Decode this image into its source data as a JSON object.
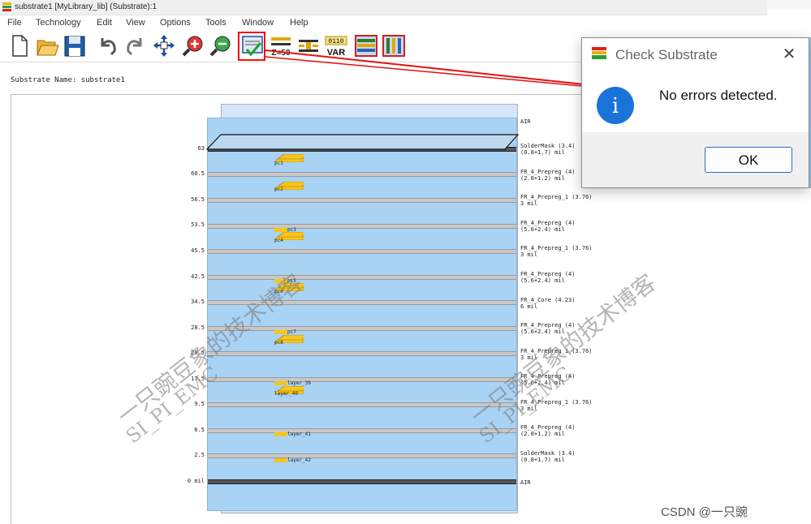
{
  "window": {
    "title": "substrate1 [MyLibrary_lib] (Substrate):1"
  },
  "menu": [
    "File",
    "Technology",
    "Edit",
    "View",
    "Options",
    "Tools",
    "Window",
    "Help"
  ],
  "toolbar": {
    "buttons": [
      "new-file-icon",
      "open-folder-icon",
      "save-icon",
      "undo-icon",
      "redo-icon",
      "move-icon",
      "zoom-in-icon",
      "zoom-out-icon",
      "check-substrate-icon",
      "z50-icon",
      "trace-icon",
      "var-icon",
      "layers-horizontal-icon",
      "layers-vertical-icon"
    ],
    "z50_label": "Z=50",
    "var_bits": "0110",
    "var_label": "VAR"
  },
  "substrate_name": "Substrate Name:  substrate1",
  "stack": {
    "y_labels": [
      "63",
      "60.5",
      "56.5",
      "53.5",
      "45.5",
      "42.5",
      "34.5",
      "28.5",
      "20.5",
      "17.5",
      "9.5",
      "6.5",
      "2.5",
      "0 mil"
    ],
    "layer_labels": [
      [
        "AIR",
        ""
      ],
      [
        "SolderMask (3.4)",
        "(0.8+1.7) mil"
      ],
      [
        "FR_4_Prepreg (4)",
        "(2.8+1.2) mil"
      ],
      [
        "FR_4_Prepreg_1 (3.76)",
        "3 mil"
      ],
      [
        "FR_4_Prepreg (4)",
        "(5.6+2.4) mil"
      ],
      [
        "FR_4_Prepreg_1 (3.76)",
        "3 mil"
      ],
      [
        "FR_4_Prepreg (4)",
        "(5.6+2.4) mil"
      ],
      [
        "FR_4_Core (4.23)",
        "6 mil"
      ],
      [
        "FR_4_Prepreg (4)",
        "(5.6+2.4) mil"
      ],
      [
        "FR_4_Prepreg_1 (3.76)",
        "3 mil"
      ],
      [
        "FR_4_Prepreg (4)",
        "(5.6+2.4) mil"
      ],
      [
        "FR_4_Prepreg_1 (3.76)",
        "3 mil"
      ],
      [
        "FR_4_Prepreg (4)",
        "(2.8+1.2) mil"
      ],
      [
        "SolderMask (3.4)",
        "(0.8+1.7) mil"
      ],
      [
        "AIR",
        ""
      ]
    ],
    "traces": [
      "pc1",
      "pc2",
      "pc3",
      "pc4",
      "pc5",
      "pc6",
      "pc7",
      "pc8",
      "layer_39",
      "layer_40",
      "layer_41",
      "layer_42"
    ]
  },
  "watermark": {
    "text_cn": "一只豌豆象的技术博客",
    "text_en": "SI_PI_EMC"
  },
  "dialog": {
    "title": "Check Substrate",
    "message": "No errors detected.",
    "ok_label": "OK",
    "close_symbol": "✕",
    "info_symbol": "i"
  },
  "footer_tag": "CSDN @一只豌",
  "colors": {
    "highlight": "#e11111",
    "dielectric": "#a9d3f5",
    "trace": "#f5c51c",
    "info_blue": "#1a73d9"
  }
}
